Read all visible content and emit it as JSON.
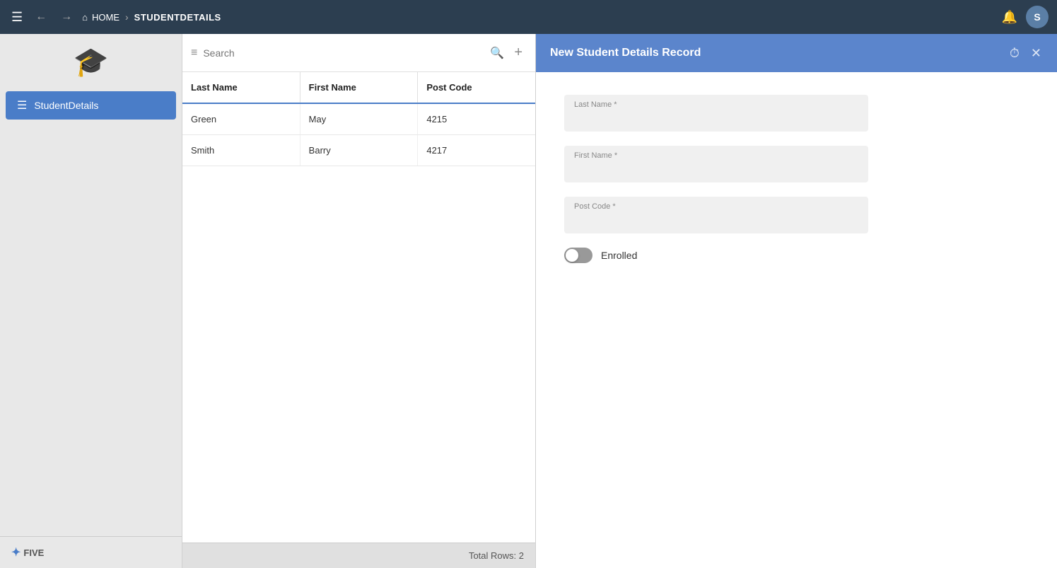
{
  "navbar": {
    "menu_label": "☰",
    "back_label": "←",
    "forward_label": "→",
    "home_label": "HOME",
    "home_icon": "⌂",
    "chevron": "›",
    "current_page": "STUDENTDETAILS",
    "bell_icon": "🔔",
    "avatar_label": "S"
  },
  "sidebar": {
    "logo_icon": "🎓",
    "item_label": "StudentDetails",
    "item_icon": "☰",
    "footer_icon": "✦",
    "footer_label": "FIVE"
  },
  "search": {
    "placeholder": "Search",
    "filter_icon": "≡",
    "search_icon": "🔍",
    "add_icon": "+"
  },
  "table": {
    "columns": [
      "Last Name",
      "First Name",
      "Post Code"
    ],
    "rows": [
      {
        "last_name": "Green",
        "first_name": "May",
        "post_code": "4215"
      },
      {
        "last_name": "Smith",
        "first_name": "Barry",
        "post_code": "4217"
      }
    ],
    "footer": "Total Rows: 2"
  },
  "form": {
    "title": "New Student Details Record",
    "clock_icon": "⏱",
    "close_icon": "✕",
    "fields": {
      "last_name_label": "Last Name *",
      "first_name_label": "First Name *",
      "post_code_label": "Post Code *"
    },
    "toggle_label": "Enrolled"
  }
}
